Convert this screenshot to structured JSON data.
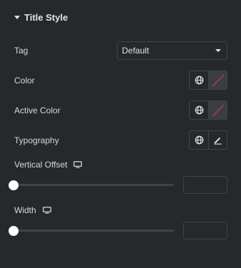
{
  "section": {
    "title": "Title Style"
  },
  "tag": {
    "label": "Tag",
    "value": "Default"
  },
  "color": {
    "label": "Color"
  },
  "active_color": {
    "label": "Active Color"
  },
  "typography": {
    "label": "Typography"
  },
  "vertical_offset": {
    "label": "Vertical Offset",
    "value": "",
    "slider_fraction": 0
  },
  "width": {
    "label": "Width",
    "value": "",
    "slider_fraction": 0
  },
  "icons": {
    "section_toggle": "caret-down-icon",
    "select_arrow": "chevron-down-icon",
    "global": "globe-icon",
    "unset_color": "no-color-swatch-icon",
    "edit": "pencil-icon",
    "responsive": "desktop-icon"
  },
  "colors": {
    "panel_bg": "#26292c",
    "border": "#3f444b",
    "text": "#d5d8dc",
    "swatch_bg": "#3a3e44",
    "swatch_slash": "#c2364b",
    "thumb": "#ffffff"
  }
}
